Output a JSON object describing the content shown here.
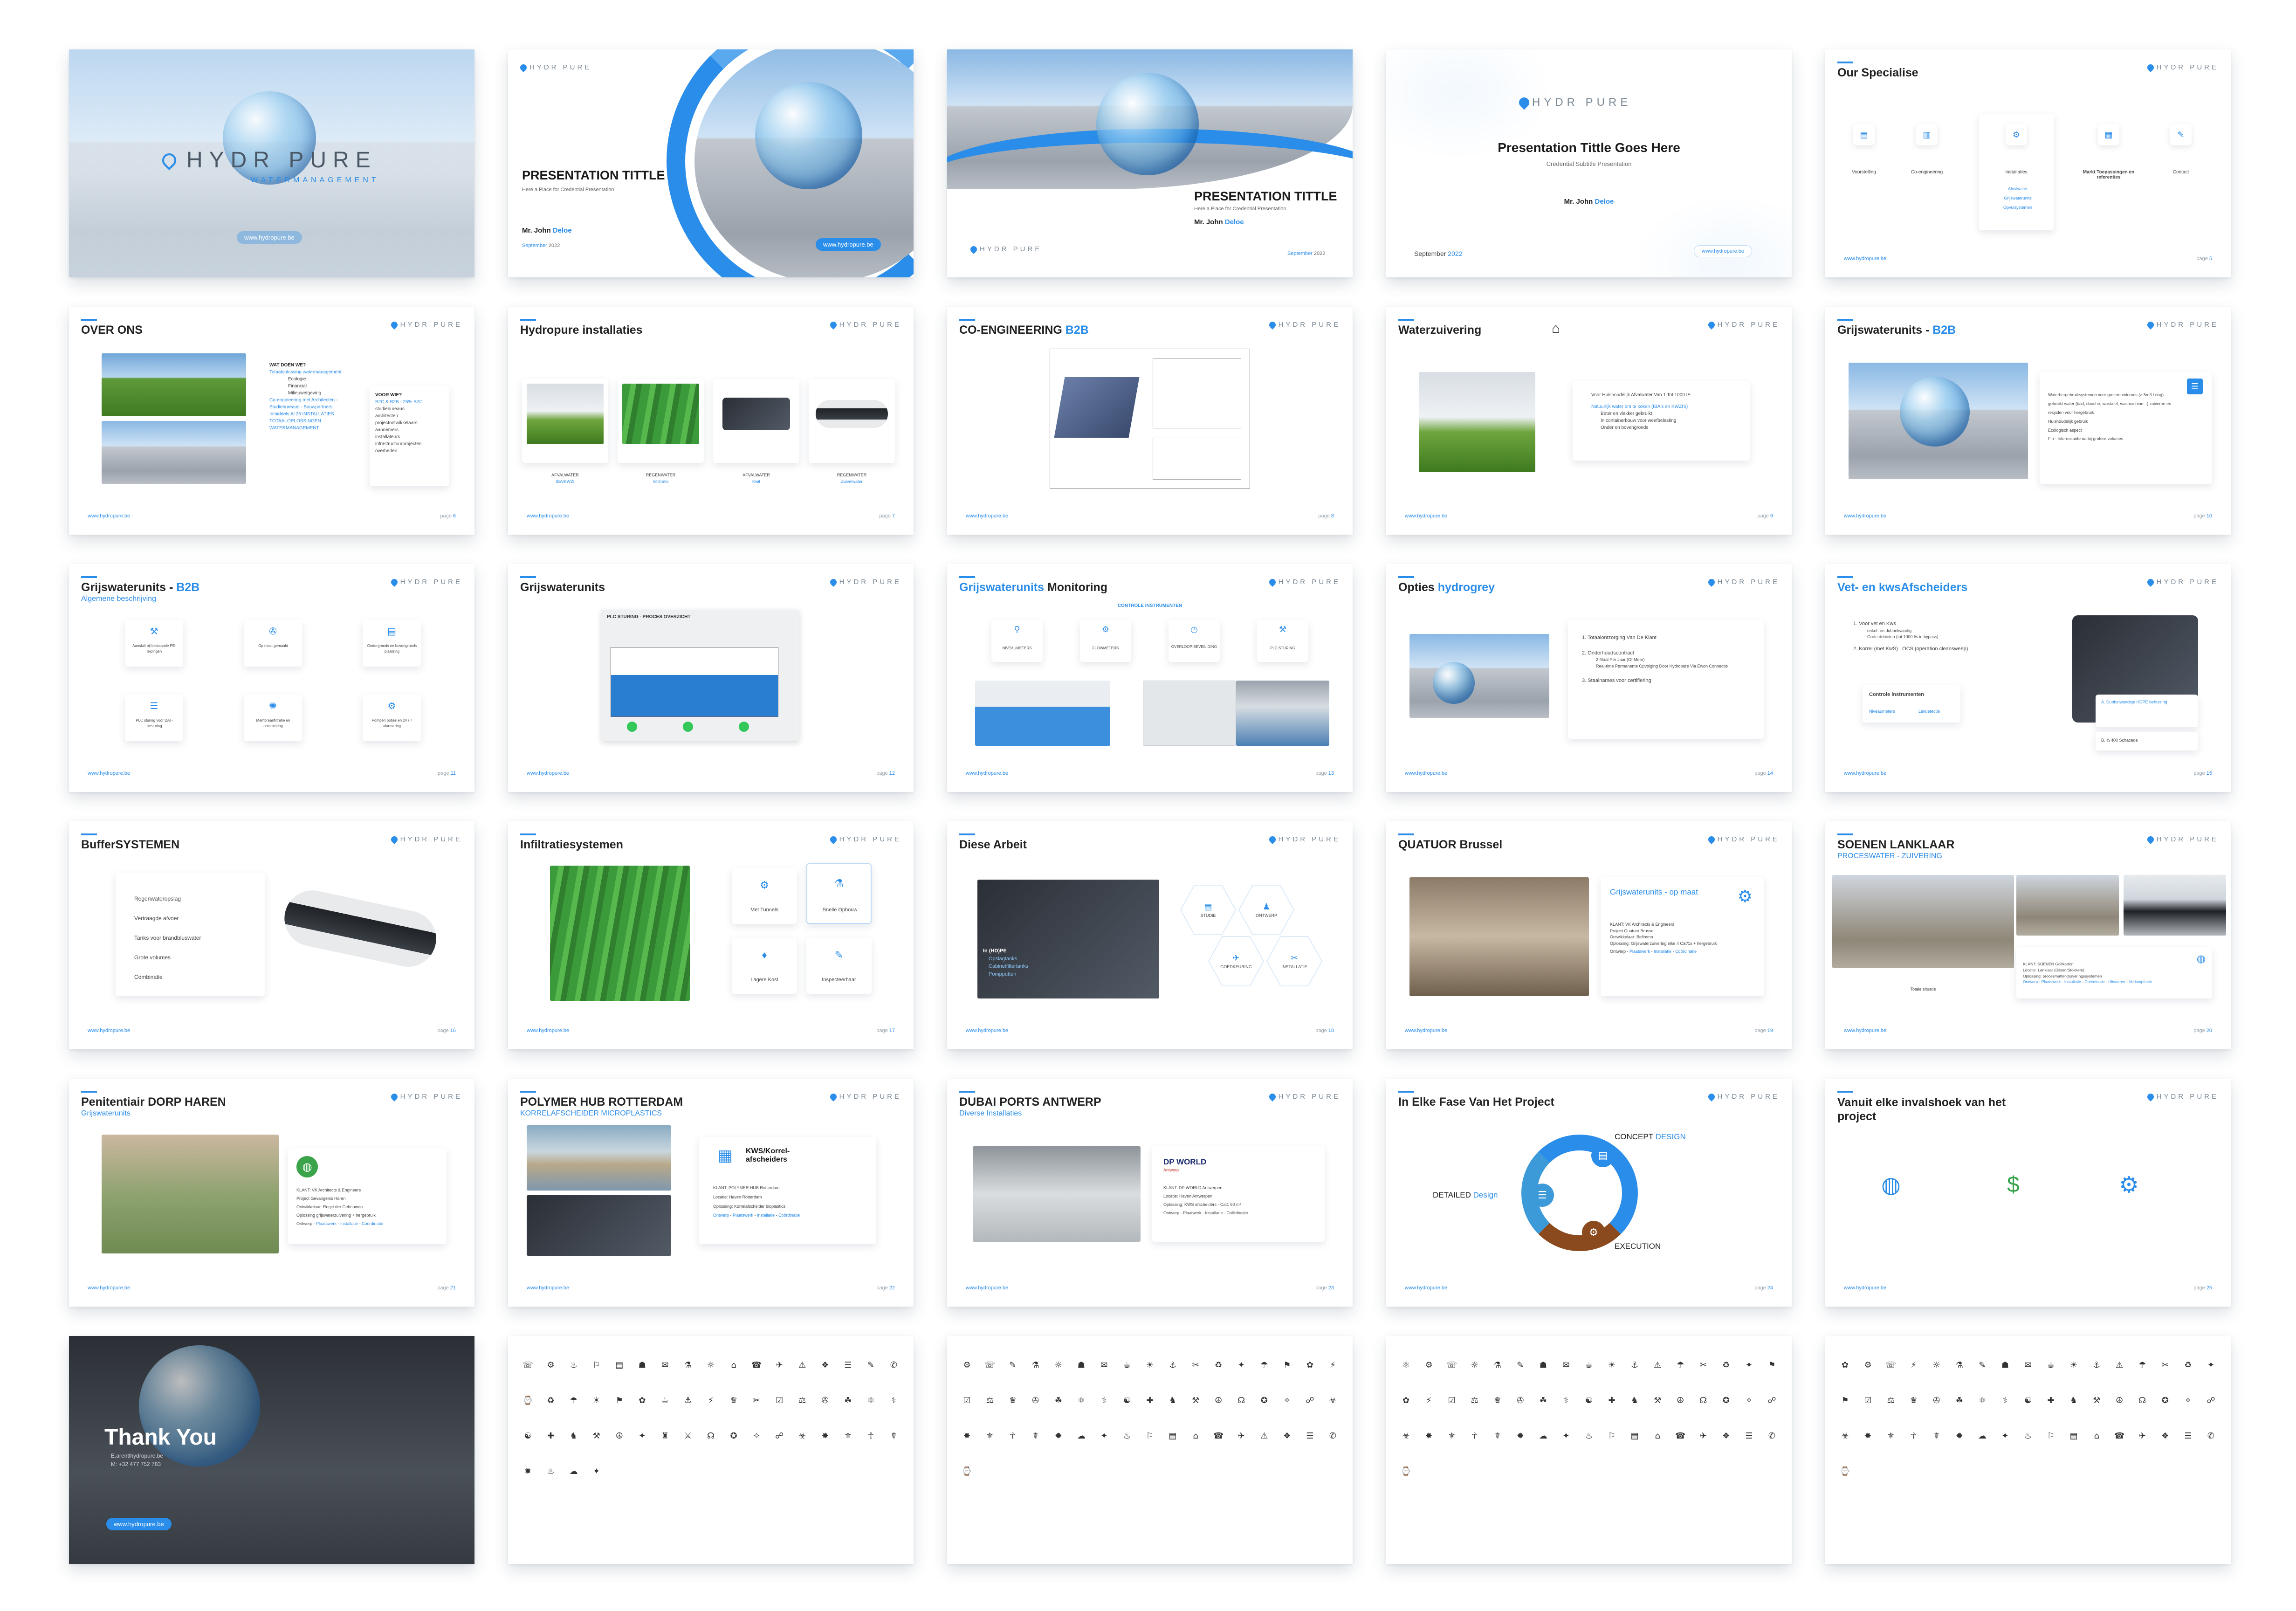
{
  "brand": {
    "logo_text": "HYDR PURE",
    "logo_sub": "WATERMANAGEMENT",
    "url": "www.hydropure.be",
    "accent": "#2a8de9"
  },
  "s1": {
    "button": "www.hydropure.be"
  },
  "s2": {
    "title": "PRESENTATION TITTLE",
    "subtitle": "Here a Place for Credential Presentation",
    "presenter_a": "Mr. John ",
    "presenter_b": "Deloe",
    "date_a": "September ",
    "date_b": "2022",
    "button": "www.hydropure.be"
  },
  "s3": {
    "title": "PRESENTATION TITTLE",
    "subtitle": "Here a Place for Credential Presentation",
    "presenter_a": "Mr. John ",
    "presenter_b": "Deloe",
    "date_a": "September ",
    "date_b": "2022"
  },
  "s4": {
    "title": "Presentation Tittle Goes Here",
    "subtitle": "Credential Subtitle Presentation",
    "presenter_a": "Mr. John ",
    "presenter_b": "Deloe",
    "date_a": "September ",
    "date_b": "2022",
    "button": "www.hydropure.be"
  },
  "s5": {
    "title": "Our Specialise",
    "items": [
      "Voorstelling",
      "Co-engineering",
      "Installaties",
      "Markt Toepassingen en referenties",
      "Contact"
    ],
    "sub_items": [
      "Afvalwater",
      "Grijswaterunits",
      "Opvulsystemen"
    ],
    "page_a": "page ",
    "page_b": "5"
  },
  "s6": {
    "title": "OVER ONS",
    "h1": "WAT DOEN WE?",
    "l1": [
      "Totaaloplossing watermanagement",
      "Ecologie",
      "Financial",
      "Milieuwetgeving",
      "Co-engineering met Architecten - Studiebureaus - Bouwpartners",
      "Inmiddels Al 25 INSTALLATIES TOTAALOPLOSSINGEN WATERMANAGEMENT"
    ],
    "h2": "VOOR WIE?",
    "l2": [
      "B2C & B2B - 25% B2C",
      "studiebureaus",
      "architecten",
      "projectontwikkelaars",
      "aannemers",
      "installateurs",
      "infrastructuurprojecten",
      "overheden"
    ],
    "page_a": "page ",
    "page_b": "6"
  },
  "s7": {
    "title": "Hydropure installaties",
    "captions": [
      [
        "AFVALWATER",
        "IBA/KWZI"
      ],
      [
        "REGENWATER",
        "Infiltratie"
      ],
      [
        "AFVALWATER",
        "Kwit"
      ],
      [
        "REGENWATER",
        "Zuivelwater"
      ]
    ],
    "page_a": "page ",
    "page_b": "7"
  },
  "s8": {
    "title_a": "CO-ENGINEERING ",
    "title_b": "B2B",
    "page_a": "page ",
    "page_b": "8"
  },
  "s9": {
    "title": "Waterzuivering",
    "l1": "Voor Huishoudelijk Afvalwater Van 1 Tot 1000 IE",
    "l2": "Natuurlijk water om te koken (IBA's en KWZI's)",
    "l3": [
      "Beter en vlakker gebruikt",
      "In containerbouw voor weefbelasting",
      "Onder en bovengronds"
    ],
    "page_a": "page ",
    "page_b": "9"
  },
  "s10": {
    "title_a": "Grijswaterunits - ",
    "title_b": "B2B",
    "lines": [
      "Waterhergebruiksystemen voor grotere volumes (> 5m3 / dag)",
      "gebruikt water (bad, douche, wastafel, wasmachine...) zuiveren en recyclen voor hergebruik",
      "Huishoudelijk gebruik",
      "Ecologisch aspect",
      "Fin - Interessante na bij grotere volumes"
    ],
    "page_a": "page ",
    "page_b": "10"
  },
  "s11": {
    "title_a": "Grijswaterunits - ",
    "title_b": "B2B",
    "subtitle": "Algemene beschrijving",
    "icons": [
      "Aansluit bij bestaande PE-leidingen",
      "Op maat gemaakt",
      "Ondergronds en bovengronds plaatsing",
      "PLC sturing voor DAT-besturing",
      "Membraanfiltratie en ontsmetting",
      "Pompen potjes en 24 / 7 alarmering"
    ],
    "page_a": "page ",
    "page_b": "11"
  },
  "s12": {
    "title": "Grijswaterunits",
    "diagram_title": "PLC STURING - PROCES OVERZICHT",
    "page_a": "page ",
    "page_b": "12"
  },
  "s13": {
    "title_a": "Grijswaterunits",
    "title_b": " Monitoring",
    "section": "CONTROLE INSTRUMENTEN",
    "icons": [
      "NIVEAUMETERS",
      "FLOWMETERS",
      "OVERLOOP-BEVEILIGING",
      "PLC STURING"
    ],
    "page_a": "page ",
    "page_b": "13"
  },
  "s14": {
    "title_a": "Opties ",
    "title_b": "hydrogrey",
    "l1": "1. Totaalontzorging Van De Klant",
    "l2": "2. Onderhoudscontract",
    "l2s": [
      "2 Maal Per Jaar (Of Meer)",
      "Real-time Permanente Opvolging Door Hydropure Via Ewon Connectie"
    ],
    "l3": "3. Staalnames voor certifiering",
    "page_a": "page ",
    "page_b": "14"
  },
  "s15": {
    "title": "Vet- en kwsAfscheiders",
    "l1": "1. Voor vet en Kws",
    "l1s": [
      "enkel- en dubbelwandig",
      "Grote debieten (tot 1000 l/s in bypass)"
    ],
    "l2": "2. Korrel (met KwS) : OCS (operation cleansweep)",
    "ctrl": "Controle instrumenten",
    "ctrl_items": [
      "Niveaumeters",
      "Lekdetectie"
    ],
    "note_a": "A. Dubbelwandige HDPE behuizing",
    "note_b": "B. ¾ 400 Schacede",
    "page_a": "page ",
    "page_b": "15"
  },
  "s16": {
    "title": "BufferSYSTEMEN",
    "items": [
      "Regenwateropslag",
      "Vertraagde afvoer",
      "Tanks voor brandbluswater",
      "Grote volumes",
      "Combinatie"
    ],
    "page_a": "page ",
    "page_b": "16"
  },
  "s17": {
    "title": "Infiltratiesystemen",
    "icons": [
      "Met Tunnels",
      "Snelle Opbouw",
      "Lagere Kost",
      "Inspecteerbaar"
    ],
    "page_a": "page ",
    "page_b": "17"
  },
  "s18": {
    "title": "Diese Arbeit",
    "caption_h": "In (HD)PE",
    "caption_l": [
      "Opslagtanks",
      "Cabinetfiltertanks",
      "Pompputten"
    ],
    "hexes": [
      "STUDIE",
      "ONTWERP",
      "GOEDKEURING",
      "INSTALLATIE"
    ],
    "page_a": "page ",
    "page_b": "18"
  },
  "s19": {
    "title": "QUATUOR Brussel",
    "card_title": "Grijswaterunits - op maat",
    "lines": [
      "KLANT: VK Architects & Engineers",
      "Project Quatuor Brussel",
      "Ontwikkelaar: Befimmo",
      "Oplossing: Grijswaterzuivering elke 4 Cat/1s + hergebruik"
    ],
    "chain": [
      "Ontwerp",
      "Plaatswerk",
      "Installatie",
      "Coördinatie"
    ],
    "page_a": "page ",
    "page_b": "19"
  },
  "s20": {
    "title": "SOENEN LANKLAAR",
    "subtitle": "PROCESWATER - ZUIVERING",
    "caption": "Totale situatie",
    "lines": [
      "KLANT: SOENEN Golfkarton",
      "Locatie: Lanklaar (Dilsen/Stokkem)",
      "Oplossing: procesmatter-zuiveringssystemen"
    ],
    "chain": [
      "Ontwerp",
      "Plaatswerk",
      "Installatie",
      "Coördinatie",
      "Uitvoeren",
      "Verkoopfacte"
    ],
    "page_a": "page ",
    "page_b": "20"
  },
  "s21": {
    "title": "Penitentiair DORP HAREN",
    "subtitle": "Grijswaterunits",
    "lines": [
      "KLANT: VK Architects & Engineers",
      "Project Gevangenis Haren",
      "Ontwikkelaar: Regie der Gebouwen",
      "Oplossing grijswaterzuivering + hergebruik"
    ],
    "chain": [
      "Ontwerp",
      "Plaatswerk",
      "Installatie",
      "Coördinatie"
    ],
    "page_a": "page ",
    "page_b": "21"
  },
  "s22": {
    "title": "POLYMER HUB ROTTERDAM",
    "subtitle": "KORRELAFSCHEIDER MICROPLASTICS",
    "card_title": "KWS/Korrel-afscheiders",
    "lines": [
      "KLANT: POLYMER HUB Rotterdam",
      "Locatie: Haven Rotterdam",
      "Oplossing: Korrelafscheider bioplastics"
    ],
    "chain": [
      "Ontwerp",
      "Plaatswerk",
      "Installatie",
      "Coördinatie"
    ],
    "page_a": "page ",
    "page_b": "22"
  },
  "s23": {
    "title": "DUBAI PORTS ANTWERP",
    "subtitle": "Diverse Installaties",
    "brand": "DP WORLD",
    "brand_sub": "Antwerp",
    "lines": [
      "KLANT: DP WORLD Antwerpen",
      "Locatie: Haven Antwerpen",
      "Oplossing: KWS afscheiders - Cat1 60 m³",
      "Ontwerp - Plaatwerk - Installatie - Coördinatie"
    ],
    "page_a": "page ",
    "page_b": "23"
  },
  "s24": {
    "title": "In Elke Fase Van Het Project",
    "concept_a": "CONCEPT ",
    "concept_b": "DESIGN",
    "detailed_a": "DETAILED ",
    "detailed_b": "Design",
    "execution": "EXECUTION",
    "page_a": "page ",
    "page_b": "24"
  },
  "s25": {
    "title": "Vanuit elke invalshoek van het project",
    "page_a": "page ",
    "page_b": "25"
  },
  "s26": {
    "title": "Thank You",
    "email": "E.arentlhydropure.be",
    "phone": "M: +32 477 752 783",
    "button": "www.hydropure.be"
  },
  "icon_sheets": [
    "☏⚙♨⚐▤☗✉⚗☼⌂☎✈⚠❖☰✎✆⌚♻☂☀⚑✿☕⚓⚡♛✂☑⚖✇☘⚛⚕☯✚♞⚒☮✦♜⚔☊✪✧☍☣✸⚜☥☤✹♨☁✦",
    "⚙☏✎⚗☼☗✉☕☀⚓✂♻✦☂⚑✿⚡☑⚖♛✇☘⚛⚕☯✚♞⚒☮☊✪✧☍☣✸⚜☥☤✹☁✦♨⚐▤⌂☎✈⚠❖☰✆⌚",
    "⚛⚙☏☼⚗✎☗✉☕☀⚓⚠☂✂♻✦⚑✿⚡☑⚖♛✇☘⚕☯✚♞⚒☮☊✪✧☍☣✸⚜☥☤✹☁✦♨⚐▤⌂☎✈❖☰✆⌚",
    "✿⚙☏⚡☼⚗✎☗✉☕☀⚓⚠☂✂♻✦⚑☑⚖♛✇☘⚛⚕☯✚♞⚒☮☊✪✧☍☣✸⚜☥☤✹☁✦♨⚐▤⌂☎✈❖☰✆⌚",
    "☘⚙☏⚡☼⚗✎☗✉☕☀⚓⚠☂✂♻✦⚑✿☑⚖♛✇⚛⚕☯✚♞⚒☮☊✪✧☍☣✸⚜☥☤✹☁✦♨⚐▤⌂☎✈❖☰✆⌚"
  ]
}
